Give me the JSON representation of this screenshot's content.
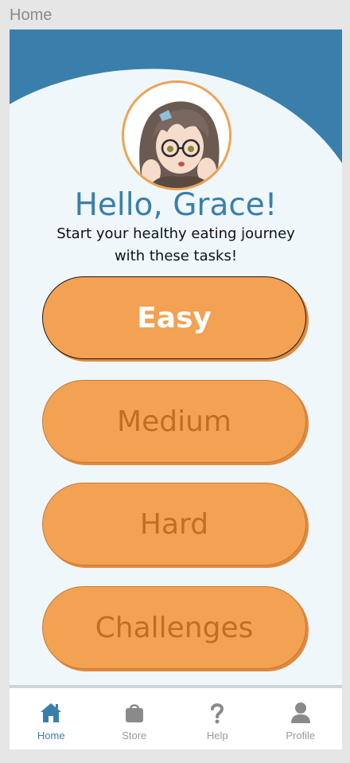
{
  "frame": {
    "label": "Home"
  },
  "colors": {
    "primary": "#3a7fab",
    "accent": "#f3a153",
    "background": "#eff7fb",
    "inactive": "#9a9a9a"
  },
  "profile": {
    "greeting": "Hello, Grace!",
    "subtitle": "Start your healthy eating journey with these tasks!",
    "avatar_icon": "anime-girl-avatar"
  },
  "tasks": [
    {
      "label": "Easy",
      "selected": true
    },
    {
      "label": "Medium",
      "selected": false
    },
    {
      "label": "Hard",
      "selected": false
    },
    {
      "label": "Challenges",
      "selected": false
    }
  ],
  "nav": {
    "items": [
      {
        "label": "Home",
        "icon": "home-icon",
        "active": true
      },
      {
        "label": "Store",
        "icon": "shopping-bag-icon",
        "active": false
      },
      {
        "label": "Help",
        "icon": "question-icon",
        "active": false
      },
      {
        "label": "Profile",
        "icon": "user-icon",
        "active": false
      }
    ]
  }
}
